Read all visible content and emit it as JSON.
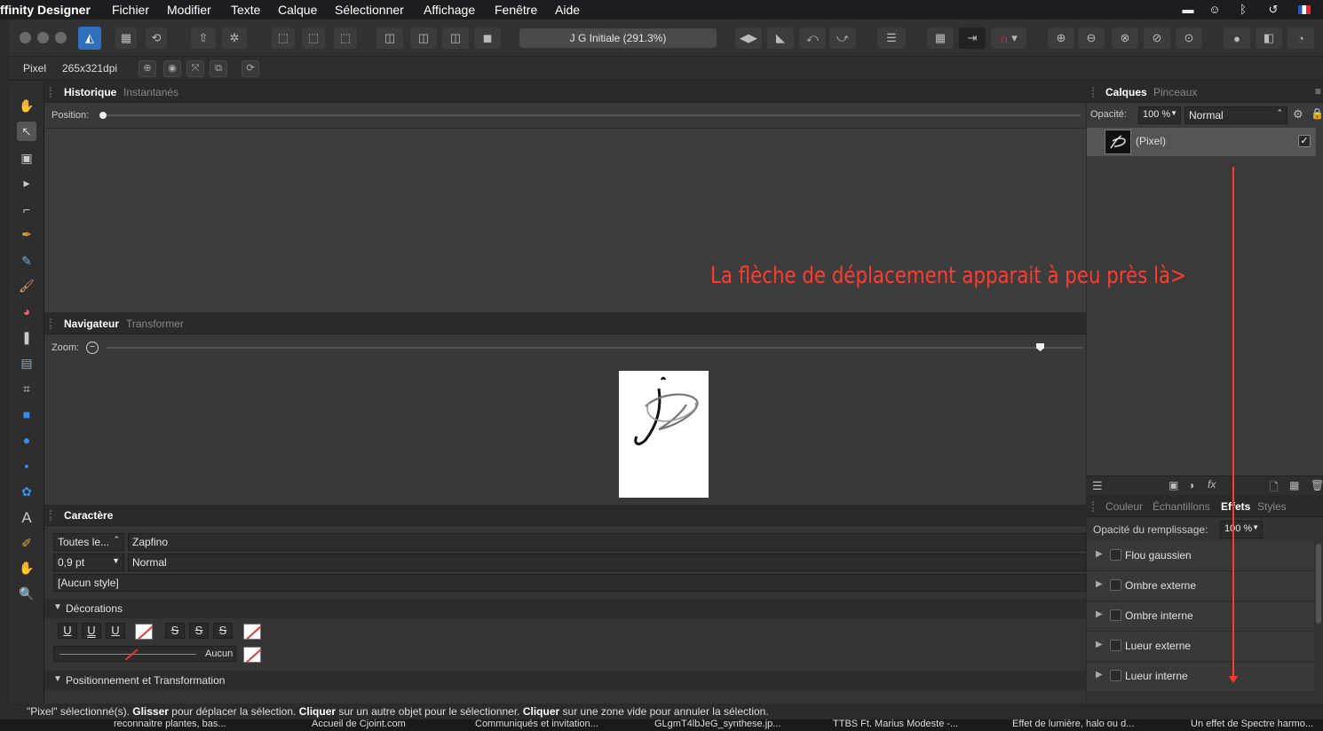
{
  "menubar": {
    "app": "ffinity Designer",
    "items": [
      "Fichier",
      "Modifier",
      "Texte",
      "Calque",
      "Sélectionner",
      "Affichage",
      "Fenêtre",
      "Aide"
    ]
  },
  "toolbar": {
    "doc_title": "J G Initiale (291.3%)"
  },
  "context": {
    "unit": "Pixel",
    "dpi": "265x321dpi"
  },
  "historique": {
    "tabs": [
      "Historique",
      "Instantanés"
    ],
    "position_label": "Position:"
  },
  "navigator": {
    "tabs": [
      "Navigateur",
      "Transformer"
    ],
    "zoom_label": "Zoom:"
  },
  "character": {
    "tab": "Caractère",
    "collection": "Toutes le...",
    "font": "Zapfino",
    "size": "0,9 pt",
    "weight": "Normal",
    "style": "[Aucun style]",
    "decorations_label": "Décorations",
    "deco_buttons": [
      "U",
      "U",
      "U",
      "S",
      "S",
      "S"
    ],
    "line_value": "Aucun",
    "positioning_label": "Positionnement et Transformation"
  },
  "layers": {
    "tabs": [
      "Calques",
      "Pinceaux"
    ],
    "opacity_label": "Opacité:",
    "opacity": "100 %",
    "blend": "Normal",
    "layer_name": "(Pixel)"
  },
  "effects": {
    "tabs": [
      "Couleur",
      "Échantillons",
      "Effets",
      "Styles"
    ],
    "fill_opacity_label": "Opacité du remplissage:",
    "fill_opacity": "100 %",
    "items": [
      "Flou gaussien",
      "Ombre externe",
      "Ombre interne",
      "Lueur externe",
      "Lueur interne"
    ]
  },
  "annotation": {
    "text": "La flèche de déplacement apparait à peu près là>",
    "color": "#ff3b2f"
  },
  "status": {
    "p1": "\"Pixel\" sélectionné(s). ",
    "b1": "Glisser",
    "p2": " pour déplacer la sélection. ",
    "b2": "Cliquer",
    "p3": " sur un autre objet pour le sélectionner. ",
    "b3": "Cliquer",
    "p4": " sur une zone vide pour annuler la sélection."
  },
  "taskbar": [
    "reconnaitre plantes, bas...",
    "Accueil de Cjoint.com",
    "Communiqués et invitation...",
    "GLgmT4lbJeG_synthese.jp...",
    "TTBS Ft. Marius Modeste -...",
    "Effet de lumière, halo ou d...",
    "Un effet de Spectre harmo..."
  ],
  "colors": {
    "accent": "#2f6fbf",
    "annotation": "#ff3b2f"
  }
}
